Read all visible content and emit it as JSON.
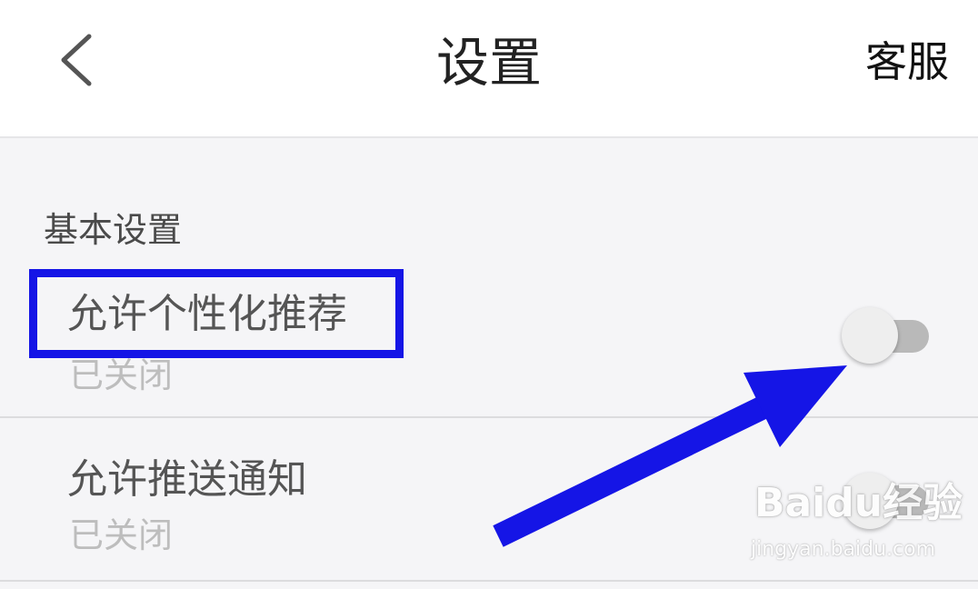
{
  "header": {
    "back_icon": "chevron-left-icon",
    "title": "设置",
    "service_label": "客服"
  },
  "section": {
    "title": "基本设置"
  },
  "settings": [
    {
      "label": "允许个性化推荐",
      "status": "已关闭",
      "enabled": false
    },
    {
      "label": "允许推送通知",
      "status": "已关闭",
      "enabled": false
    }
  ],
  "annotation": {
    "box_color": "#1515e6",
    "arrow_color": "#1515e6"
  },
  "watermark": {
    "logo_text": "Baidu经验",
    "url": "jingyan.baidu.com"
  },
  "colors": {
    "header_bg": "#ffffff",
    "page_bg": "#f5f5f7",
    "toggle_off_track": "#b9b9b9",
    "toggle_knob": "#eeeeee"
  }
}
